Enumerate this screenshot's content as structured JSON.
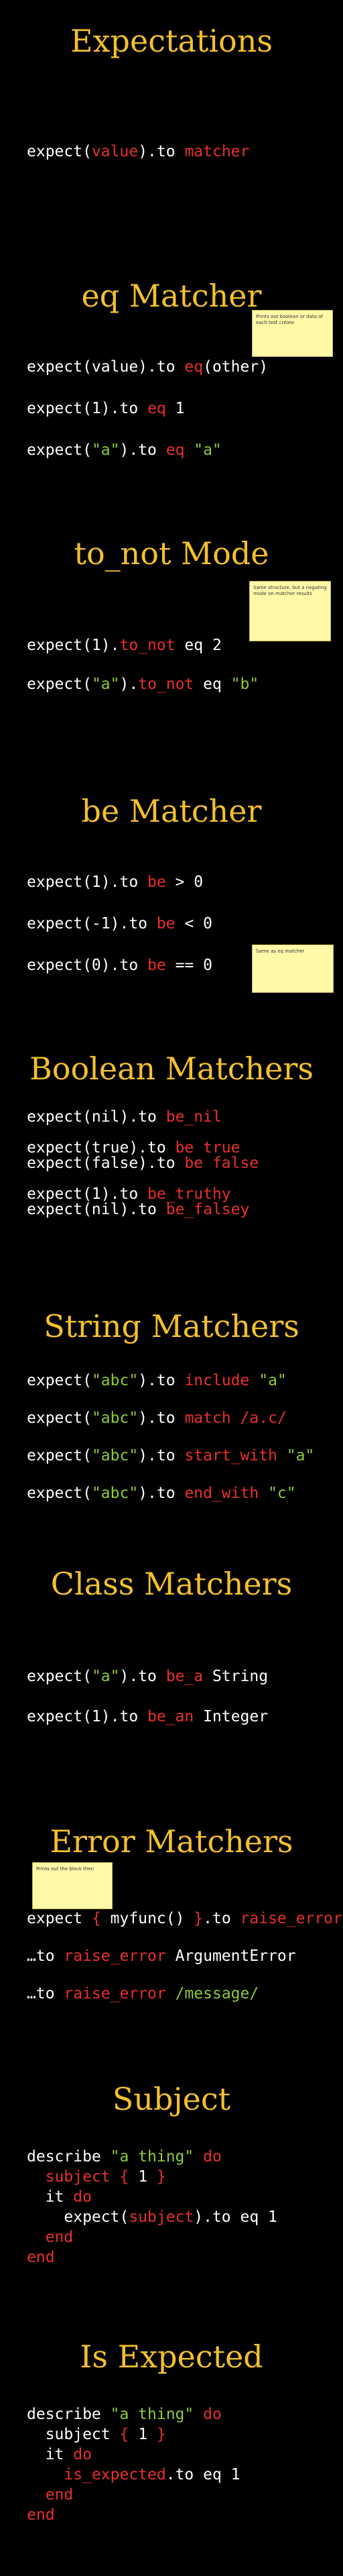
{
  "slides": [
    {
      "title": "Expectations",
      "lines": [
        [
          {
            "t": "expect("
          },
          {
            "t": "value",
            "c": "r"
          },
          {
            "t": ").to "
          },
          {
            "t": "matcher",
            "c": "r"
          }
        ]
      ]
    },
    {
      "title": "eq Matcher",
      "note": "Prints out boolean or data of each test create",
      "lines": [
        [
          {
            "t": "expect(value).to "
          },
          {
            "t": "eq",
            "c": "r"
          },
          {
            "t": "(other)"
          }
        ],
        [],
        [
          {
            "t": "expect(1).to "
          },
          {
            "t": "eq",
            "c": "r"
          },
          {
            "t": " 1"
          }
        ],
        [],
        [
          {
            "t": "expect("
          },
          {
            "t": "\"a\"",
            "c": "g"
          },
          {
            "t": ").to "
          },
          {
            "t": "eq",
            "c": "r"
          },
          {
            "t": " "
          },
          {
            "t": "\"a\"",
            "c": "g"
          }
        ]
      ]
    },
    {
      "title": "to_not Mode",
      "note": "Same structure, but a negating mode on matcher results",
      "lines": [
        [
          {
            "t": "expect(1)."
          },
          {
            "t": "to_not",
            "c": "r"
          },
          {
            "t": " eq 2"
          }
        ],
        [],
        [
          {
            "t": "expect("
          },
          {
            "t": "\"a\"",
            "c": "g"
          },
          {
            "t": ")."
          },
          {
            "t": "to_not",
            "c": "r"
          },
          {
            "t": " eq "
          },
          {
            "t": "\"b\"",
            "c": "g"
          }
        ]
      ]
    },
    {
      "title": "be Matcher",
      "note": "Same as eq matcher",
      "lines": [
        [
          {
            "t": "expect(1).to "
          },
          {
            "t": "be",
            "c": "r"
          },
          {
            "t": " > 0"
          }
        ],
        [],
        [
          {
            "t": "expect(-1).to "
          },
          {
            "t": "be",
            "c": "r"
          },
          {
            "t": " < 0"
          }
        ],
        [],
        [
          {
            "t": "expect(0).to "
          },
          {
            "t": "be",
            "c": "r"
          },
          {
            "t": " == 0"
          }
        ]
      ]
    },
    {
      "title": "Boolean Matchers",
      "lines": [
        [
          {
            "t": "expect(nil).to "
          },
          {
            "t": "be_nil",
            "c": "r"
          }
        ],
        [],
        [
          {
            "t": "expect(true).to "
          },
          {
            "t": "be true",
            "c": "r"
          }
        ],
        [
          {
            "t": "expect(false).to "
          },
          {
            "t": "be false",
            "c": "r"
          }
        ],
        [],
        [
          {
            "t": "expect(1).to "
          },
          {
            "t": "be_truthy",
            "c": "r"
          }
        ],
        [
          {
            "t": "expect(nil).to "
          },
          {
            "t": "be_falsey",
            "c": "r"
          }
        ]
      ]
    },
    {
      "title": "String Matchers",
      "lines": [
        [
          {
            "t": "expect("
          },
          {
            "t": "\"abc\"",
            "c": "g"
          },
          {
            "t": ").to "
          },
          {
            "t": "include",
            "c": "r"
          },
          {
            "t": " "
          },
          {
            "t": "\"a\"",
            "c": "g"
          }
        ],
        [],
        [
          {
            "t": "expect("
          },
          {
            "t": "\"abc\"",
            "c": "g"
          },
          {
            "t": ").to "
          },
          {
            "t": "match",
            "c": "r"
          },
          {
            "t": " "
          },
          {
            "t": "/a.c/",
            "c": "r"
          }
        ],
        [],
        [
          {
            "t": "expect("
          },
          {
            "t": "\"abc\"",
            "c": "g"
          },
          {
            "t": ").to "
          },
          {
            "t": "start_with",
            "c": "r"
          },
          {
            "t": " "
          },
          {
            "t": "\"a\"",
            "c": "g"
          }
        ],
        [],
        [
          {
            "t": "expect("
          },
          {
            "t": "\"abc\"",
            "c": "g"
          },
          {
            "t": ").to "
          },
          {
            "t": "end_with",
            "c": "r"
          },
          {
            "t": " "
          },
          {
            "t": "\"c\"",
            "c": "g"
          }
        ]
      ]
    },
    {
      "title": "Class Matchers",
      "lines": [
        [
          {
            "t": "expect("
          },
          {
            "t": "\"a\"",
            "c": "g"
          },
          {
            "t": ").to "
          },
          {
            "t": "be_a",
            "c": "r"
          },
          {
            "t": " String"
          }
        ],
        [],
        [
          {
            "t": "expect(1).to "
          },
          {
            "t": "be_an",
            "c": "r"
          },
          {
            "t": " Integer"
          }
        ]
      ]
    },
    {
      "title": "Error Matchers",
      "note": "Prints out the block then",
      "lines": [
        [
          {
            "t": "expect "
          },
          {
            "t": "{",
            "c": "r"
          },
          {
            "t": " myfunc() "
          },
          {
            "t": "}",
            "c": "r"
          },
          {
            "t": ".to "
          },
          {
            "t": "raise_error",
            "c": "r"
          }
        ],
        [],
        [
          {
            "t": "…to "
          },
          {
            "t": "raise_error",
            "c": "r"
          },
          {
            "t": " ArgumentError"
          }
        ],
        [],
        [
          {
            "t": "…to "
          },
          {
            "t": "raise_error",
            "c": "r"
          },
          {
            "t": " "
          },
          {
            "t": "/message/",
            "c": "g"
          }
        ]
      ]
    },
    {
      "title": "Subject",
      "lines": [
        [
          {
            "t": "describe "
          },
          {
            "t": "\"a thing\"",
            "c": "g"
          },
          {
            "t": " "
          },
          {
            "t": "do",
            "c": "r"
          }
        ],
        [
          {
            "t": "  "
          },
          {
            "t": "subject",
            "c": "r"
          },
          {
            "t": " "
          },
          {
            "t": "{",
            "c": "r"
          },
          {
            "t": " 1 "
          },
          {
            "t": "}",
            "c": "r"
          }
        ],
        [
          {
            "t": "  it "
          },
          {
            "t": "do",
            "c": "r"
          }
        ],
        [
          {
            "t": "    expect("
          },
          {
            "t": "subject",
            "c": "r"
          },
          {
            "t": ").to eq 1"
          }
        ],
        [
          {
            "t": "  "
          },
          {
            "t": "end",
            "c": "r"
          }
        ],
        [
          {
            "t": "end",
            "c": "r"
          }
        ]
      ]
    },
    {
      "title": "Is Expected",
      "lines": [
        [
          {
            "t": "describe "
          },
          {
            "t": "\"a thing\"",
            "c": "g"
          },
          {
            "t": " "
          },
          {
            "t": "do",
            "c": "r"
          }
        ],
        [
          {
            "t": "  subject "
          },
          {
            "t": "{",
            "c": "r"
          },
          {
            "t": " 1 "
          },
          {
            "t": "}",
            "c": "r"
          }
        ],
        [
          {
            "t": "  it "
          },
          {
            "t": "do",
            "c": "r"
          }
        ],
        [
          {
            "t": "    "
          },
          {
            "t": "is_expected",
            "c": "r"
          },
          {
            "t": ".to eq 1"
          }
        ],
        [
          {
            "t": "  "
          },
          {
            "t": "end",
            "c": "r"
          }
        ],
        [
          {
            "t": "end",
            "c": "r"
          }
        ]
      ]
    }
  ]
}
